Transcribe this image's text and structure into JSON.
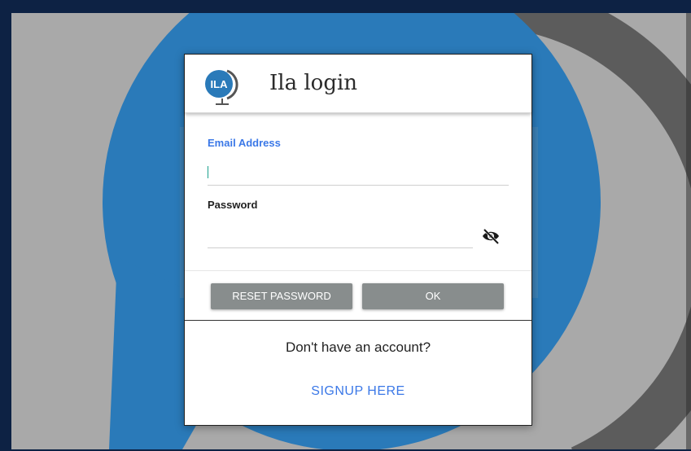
{
  "dialog": {
    "title": "Ila login",
    "logo_text": "ILA"
  },
  "form": {
    "email_label": "Email Address",
    "email_value": "",
    "password_label": "Password",
    "password_value": "",
    "password_visibility_icon": "eye-off-icon"
  },
  "actions": {
    "reset_label": "RESET PASSWORD",
    "ok_label": "OK"
  },
  "footer": {
    "prompt": "Don't have an account?",
    "signup_label": "SIGNUP HERE"
  },
  "colors": {
    "accent": "#3b78e7",
    "button": "#888d8d",
    "backdrop": "#a9a9a9",
    "frame": "#0d2244",
    "logo_blue": "#2a7ab9"
  }
}
